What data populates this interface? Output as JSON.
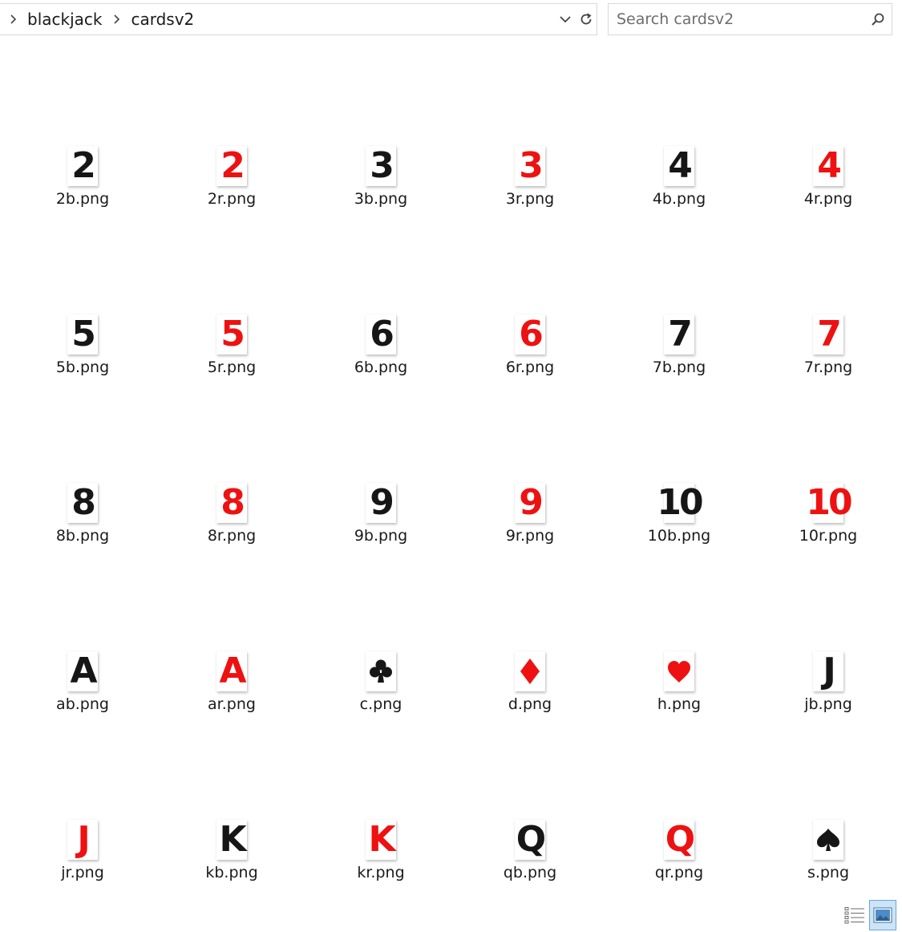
{
  "breadcrumb": {
    "items": [
      "blackjack",
      "cardsv2"
    ]
  },
  "search": {
    "placeholder": "Search cardsv2"
  },
  "files": [
    {
      "name": "2b.png",
      "glyph": "2",
      "color": "black"
    },
    {
      "name": "2r.png",
      "glyph": "2",
      "color": "red"
    },
    {
      "name": "3b.png",
      "glyph": "3",
      "color": "black"
    },
    {
      "name": "3r.png",
      "glyph": "3",
      "color": "red"
    },
    {
      "name": "4b.png",
      "glyph": "4",
      "color": "black"
    },
    {
      "name": "4r.png",
      "glyph": "4",
      "color": "red"
    },
    {
      "name": "5b.png",
      "glyph": "5",
      "color": "black"
    },
    {
      "name": "5r.png",
      "glyph": "5",
      "color": "red"
    },
    {
      "name": "6b.png",
      "glyph": "6",
      "color": "black"
    },
    {
      "name": "6r.png",
      "glyph": "6",
      "color": "red"
    },
    {
      "name": "7b.png",
      "glyph": "7",
      "color": "black"
    },
    {
      "name": "7r.png",
      "glyph": "7",
      "color": "red"
    },
    {
      "name": "8b.png",
      "glyph": "8",
      "color": "black"
    },
    {
      "name": "8r.png",
      "glyph": "8",
      "color": "red"
    },
    {
      "name": "9b.png",
      "glyph": "9",
      "color": "black"
    },
    {
      "name": "9r.png",
      "glyph": "9",
      "color": "red"
    },
    {
      "name": "10b.png",
      "glyph": "10",
      "color": "black"
    },
    {
      "name": "10r.png",
      "glyph": "10",
      "color": "red"
    },
    {
      "name": "ab.png",
      "glyph": "A",
      "color": "black"
    },
    {
      "name": "ar.png",
      "glyph": "A",
      "color": "red"
    },
    {
      "name": "c.png",
      "icon": "club-icon",
      "color": "black"
    },
    {
      "name": "d.png",
      "icon": "diamond-icon",
      "color": "red"
    },
    {
      "name": "h.png",
      "icon": "heart-icon",
      "color": "red"
    },
    {
      "name": "jb.png",
      "glyph": "J",
      "color": "black"
    },
    {
      "name": "jr.png",
      "glyph": "J",
      "color": "red"
    },
    {
      "name": "kb.png",
      "glyph": "K",
      "color": "black"
    },
    {
      "name": "kr.png",
      "glyph": "K",
      "color": "red"
    },
    {
      "name": "qb.png",
      "glyph": "Q",
      "color": "black"
    },
    {
      "name": "qr.png",
      "glyph": "Q",
      "color": "red"
    },
    {
      "name": "s.png",
      "icon": "spade-icon",
      "color": "black"
    }
  ],
  "colors": {
    "black": "#161616",
    "red": "#ee1111",
    "selected_view_bg": "#cce4f7"
  },
  "view_modes": {
    "active": "large-icons"
  }
}
